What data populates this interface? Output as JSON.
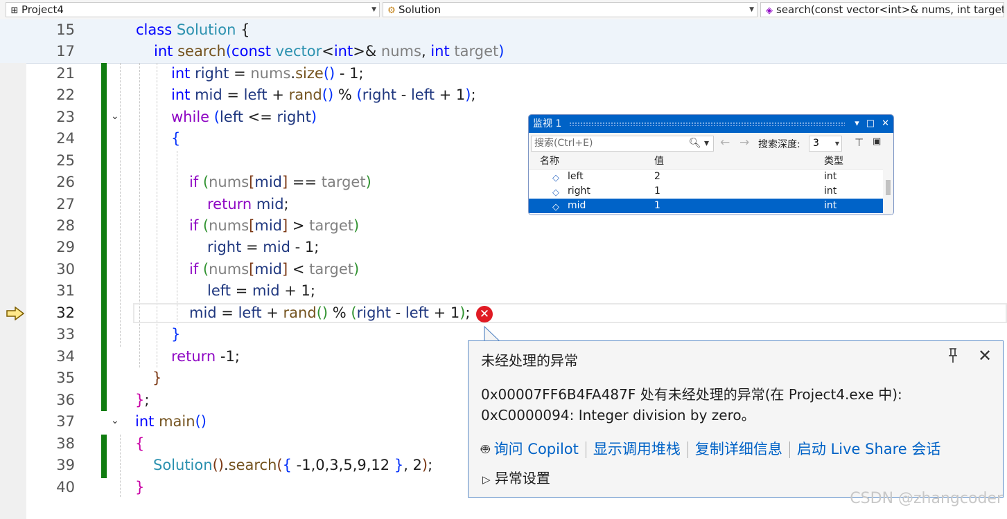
{
  "navbar": {
    "project": "Project4",
    "class": "Solution",
    "member": "search(const vector<int>& nums, int target)"
  },
  "sticky": [
    {
      "num": "15"
    },
    {
      "num": "17"
    }
  ],
  "lines": [
    {
      "num": "21"
    },
    {
      "num": "22"
    },
    {
      "num": "23"
    },
    {
      "num": "24"
    },
    {
      "num": "25"
    },
    {
      "num": "26"
    },
    {
      "num": "27"
    },
    {
      "num": "28"
    },
    {
      "num": "29"
    },
    {
      "num": "30"
    },
    {
      "num": "31"
    },
    {
      "num": "32"
    },
    {
      "num": "33"
    },
    {
      "num": "34"
    },
    {
      "num": "35"
    },
    {
      "num": "36"
    },
    {
      "num": "37"
    },
    {
      "num": "38"
    },
    {
      "num": "39"
    },
    {
      "num": "40"
    }
  ],
  "code": {
    "l15": {
      "class": "class",
      "name": "Solution",
      "brace": "{"
    },
    "l17": {
      "int": "int",
      "fn": "search",
      "open": "(",
      "const": "const",
      "vector": "vector",
      "lt": "<",
      "int2": "int",
      "gt": ">&",
      "nums": "nums",
      "comma": ",",
      "int3": "int",
      "target": "target",
      "close": ")"
    },
    "l21": {
      "int": "int",
      "var": "right",
      "eq": " = ",
      "nums": "nums",
      "dot": ".",
      "size": "size",
      "paren": "()",
      "rest": " - 1;"
    },
    "l22": {
      "int": "int",
      "var": "mid",
      "eq": " = ",
      "left": "left",
      "plus": " + ",
      "rand": "rand",
      "paren": "()",
      "mod": " % ",
      "open": "(",
      "right": "right",
      "minus": " - ",
      "left2": "left",
      "plus1": " + 1",
      "close": ")",
      "semi": ";"
    },
    "l23": {
      "while": "while",
      "open": "(",
      "left": "left",
      "le": " <= ",
      "right": "right",
      "close": ")"
    },
    "l24": {
      "brace": "{"
    },
    "l26": {
      "if": "if",
      "open": "(",
      "nums": "nums",
      "b1": "[",
      "mid": "mid",
      "b2": "]",
      "op": " == ",
      "target": "target",
      "close": ")"
    },
    "l27": {
      "return": "return",
      "mid": "mid",
      "semi": ";"
    },
    "l28": {
      "if": "if",
      "open": "(",
      "nums": "nums",
      "b1": "[",
      "mid": "mid",
      "b2": "]",
      "op": " > ",
      "target": "target",
      "close": ")"
    },
    "l29": {
      "right": "right",
      "rest": " = ",
      "mid": "mid",
      "tail": " - 1;"
    },
    "l30": {
      "if": "if",
      "open": "(",
      "nums": "nums",
      "b1": "[",
      "mid": "mid",
      "b2": "]",
      "op": " < ",
      "target": "target",
      "close": ")"
    },
    "l31": {
      "left": "left",
      "rest": " = ",
      "mid": "mid",
      "tail": " + 1;"
    },
    "l32": {
      "mid": "mid",
      "eq": " = ",
      "left": "left",
      "plus": " + ",
      "rand": "rand",
      "paren": "()",
      "mod": " % ",
      "open": "(",
      "right": "right",
      "minus": " - ",
      "left2": "left",
      "plus1": " + 1",
      "close": ")",
      "semi": ";"
    },
    "l33": {
      "brace": "}"
    },
    "l34": {
      "return": "return",
      "rest": " -1;"
    },
    "l35": {
      "brace": "}"
    },
    "l36": {
      "brace": "}",
      "semi": ";"
    },
    "l37": {
      "int": "int",
      "main": "main",
      "paren": "()"
    },
    "l38": {
      "brace": "{"
    },
    "l39": {
      "sol": "Solution",
      "paren": "()",
      "dot": ".",
      "search": "search",
      "open": "(",
      "brace1": "{",
      "list": " -1,0,3,5,9,12 ",
      "brace2": "}",
      "args": ", 2",
      "close": ")",
      "semi": ";"
    },
    "l40": {
      "brace": "}"
    }
  },
  "watch": {
    "title": "监视 1",
    "search_placeholder": "搜索(Ctrl+E)",
    "depth_label": "搜索深度:",
    "depth_value": "3",
    "columns": {
      "name": "名称",
      "value": "值",
      "type": "类型"
    },
    "rows": [
      {
        "name": "left",
        "value": "2",
        "type": "int"
      },
      {
        "name": "right",
        "value": "1",
        "type": "int"
      },
      {
        "name": "mid",
        "value": "1",
        "type": "int"
      }
    ]
  },
  "exception": {
    "title": "未经处理的异常",
    "message_line1": "0x00007FF6B4FA487F 处有未经处理的异常(在 Project4.exe 中):",
    "message_line2": "0xC0000094: Integer division by zero。",
    "links": {
      "copilot": "询问 Copilot",
      "callstack": "显示调用堆栈",
      "copy": "复制详细信息",
      "liveshare": "启动 Live Share 会话"
    },
    "settings": "异常设置"
  },
  "watermark": "CSDN @zhangcoder"
}
